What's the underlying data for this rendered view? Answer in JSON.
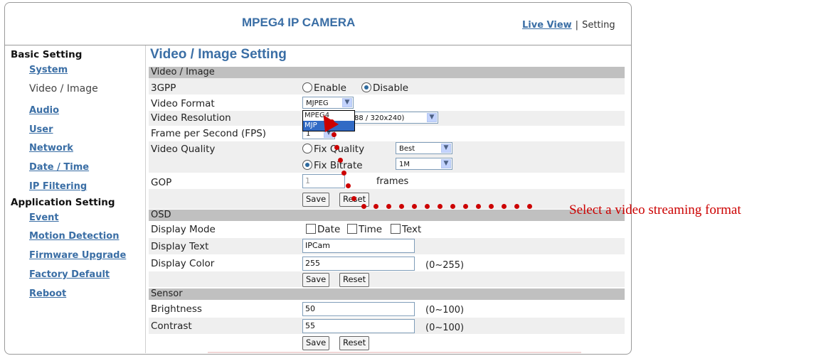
{
  "header": {
    "app_title": "MPEG4 IP CAMERA",
    "live_view": "Live View",
    "separator": "|",
    "setting": "Setting"
  },
  "sidebar": {
    "basic_heading": "Basic Setting",
    "basic_items": [
      "System",
      "Video / Image",
      "Audio",
      "User",
      "Network",
      "Date / Time",
      "IP Filtering"
    ],
    "current_item": "Video / Image",
    "app_heading": "Application Setting",
    "app_items": [
      "Event",
      "Motion Detection",
      "Firmware Upgrade",
      "Factory Default",
      "Reboot"
    ]
  },
  "main": {
    "page_title": "Video / Image Setting",
    "video_section": {
      "header": "Video / Image",
      "gpp_label": "3GPP",
      "gpp_enable": "Enable",
      "gpp_disable": "Disable",
      "gpp_selected": "Disable",
      "format_label": "Video Format",
      "format_value": "MJPEG",
      "format_options": [
        "MPEG4",
        "MJPEG"
      ],
      "format_highlighted": "MJPEG",
      "format_highlight_visible": "MJP",
      "resolution_label": "Video Resolution",
      "resolution_value": "88 / 320x240)",
      "fps_label": "Frame per Second (FPS)",
      "fps_value": "1",
      "quality_label": "Video Quality",
      "fix_quality": "Fix Quality",
      "fix_quality_value": "Best",
      "fix_bitrate": "Fix Bitrate",
      "fix_bitrate_value": "1M",
      "quality_selected": "Fix Bitrate",
      "gop_label": "GOP",
      "gop_value": "1",
      "gop_unit": "frames",
      "save": "Save",
      "reset": "Reset"
    },
    "osd_section": {
      "header": "OSD",
      "display_mode_label": "Display Mode",
      "mode_date": "Date",
      "mode_time": "Time",
      "mode_text": "Text",
      "display_text_label": "Display Text",
      "display_text_value": "IPCam",
      "display_color_label": "Display Color",
      "display_color_value": "255",
      "display_color_range": "(0~255)",
      "save": "Save",
      "reset": "Reset"
    },
    "sensor_section": {
      "header": "Sensor",
      "brightness_label": "Brightness",
      "brightness_value": "50",
      "brightness_range": "(0~100)",
      "contrast_label": "Contrast",
      "contrast_value": "55",
      "contrast_range": "(0~100)",
      "save": "Save",
      "reset": "Reset"
    }
  },
  "annotation": {
    "callout_text": "Select a video streaming format",
    "color": "#cc0000"
  },
  "colors": {
    "link": "#3a6ea5",
    "section_bar": "#c0c0c0",
    "selection": "#316ac5"
  }
}
